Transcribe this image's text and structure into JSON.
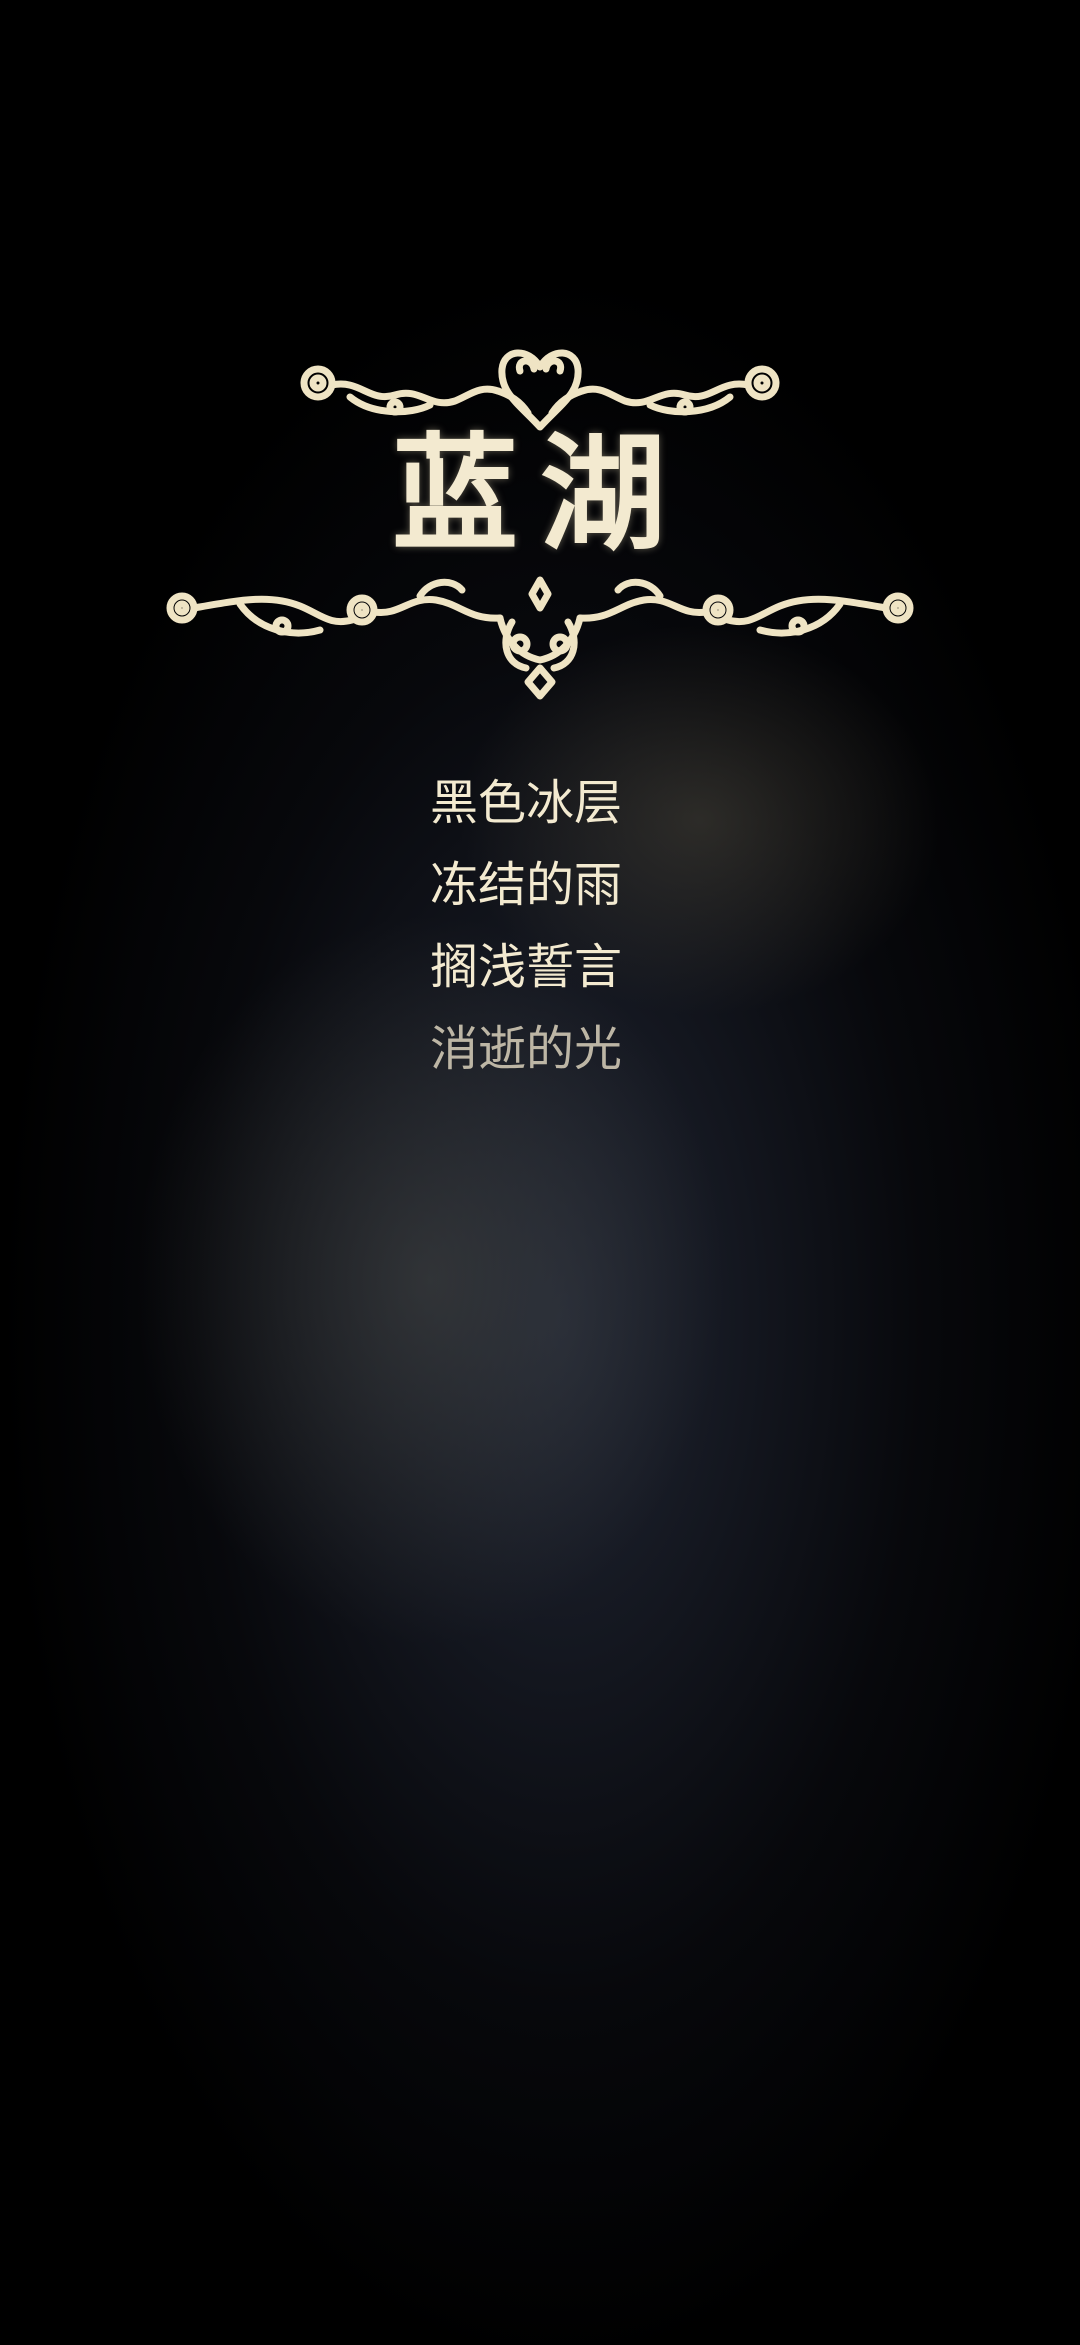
{
  "title": "蓝湖",
  "menu": {
    "items": [
      {
        "label": "黑色冰层"
      },
      {
        "label": "冻结的雨"
      },
      {
        "label": "搁浅誓言"
      },
      {
        "label": "消逝的光"
      }
    ]
  },
  "colors": {
    "text": "#f3ead0",
    "text_dim": "#bdb6a5",
    "ornament": "#efe4c4",
    "background": "#000000"
  },
  "icons": {
    "ornament_top": "scroll-flourish-icon",
    "ornament_bottom": "scroll-flourish-icon"
  }
}
